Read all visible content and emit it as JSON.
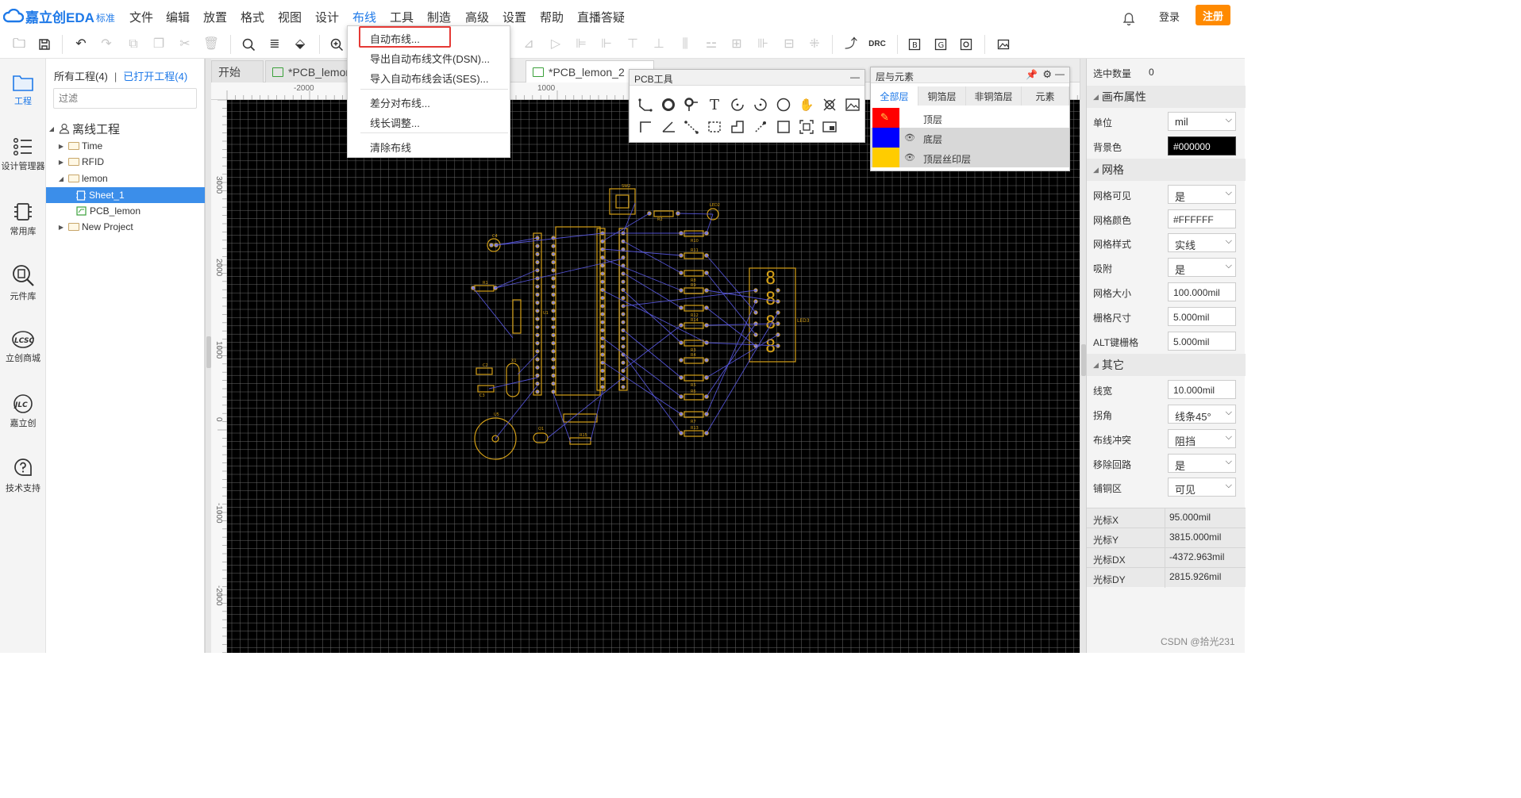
{
  "app": {
    "logo_text": "嘉立创EDA",
    "edition": "标准",
    "menus": [
      "文件",
      "编辑",
      "放置",
      "格式",
      "视图",
      "设计",
      "布线",
      "工具",
      "制造",
      "高级",
      "设置",
      "帮助",
      "直播答疑"
    ],
    "active_menu": "布线",
    "login": "登录",
    "register": "注册",
    "accent_color": "#1E79E8",
    "register_color": "#FF8A00"
  },
  "toolbar": {
    "icons": [
      "open-icon",
      "save-icon",
      "undo-icon",
      "redo-icon",
      "copy-icon",
      "duplicate-icon",
      "cut-icon",
      "delete-icon",
      "zoom-icon",
      "fit-icon",
      "erase-icon",
      "zoom-in-icon"
    ],
    "right_icons": [
      "align-left-icon",
      "align-hcenter-icon",
      "align-right-icon",
      "align-top-icon",
      "align-vcenter-icon",
      "align-bottom-icon",
      "distribute-h-icon",
      "distribute-v-icon",
      "align-grid-icon",
      "snap-icon",
      "route-icon"
    ],
    "drc_label": "DRC",
    "extra_icons": [
      "b-icon",
      "g-icon",
      "photo-icon",
      "image-icon"
    ]
  },
  "leftnav": {
    "items": [
      {
        "label": "工程",
        "icon": "folder-icon",
        "active": true
      },
      {
        "label": "设计管理器",
        "icon": "list-icon"
      },
      {
        "label": "常用库",
        "icon": "chip-icon"
      },
      {
        "label": "元件库",
        "icon": "magnifier-chip-icon"
      },
      {
        "label": "立创商城",
        "icon": "lcsc-icon"
      },
      {
        "label": "嘉立创",
        "icon": "jlc-icon"
      },
      {
        "label": "技术支持",
        "icon": "help-icon"
      }
    ],
    "lcsc_mark": "LCSC",
    "jlc_mark": "JLC"
  },
  "project": {
    "tab_all": "所有工程(4)",
    "tab_sep": "|",
    "tab_open": "已打开工程(4)",
    "filter_placeholder": "过滤",
    "root": "离线工程",
    "items": [
      "Time",
      "RFID",
      "lemon",
      "Sheet_1",
      "PCB_lemon",
      "New Project"
    ]
  },
  "doc_tabs": [
    {
      "label": "开始"
    },
    {
      "label": "*PCB_lemon"
    },
    {
      "label": "*PCB_lemon_2"
    }
  ],
  "rulers": {
    "top": [
      "-2000",
      "1000"
    ],
    "left": [
      "3000",
      "2000",
      "1000",
      "0",
      "-1000",
      "-2000"
    ]
  },
  "dropdown": {
    "items": [
      "自动布线...",
      "导出自动布线文件(DSN)...",
      "导入自动布线会话(SES)...",
      "差分对布线...",
      "线长调整...",
      "清除布线"
    ],
    "highlighted": "自动布线..."
  },
  "pcb_tools": {
    "title": "PCB工具",
    "minimize": "—",
    "row1": [
      "track-icon",
      "pad-icon",
      "via-icon",
      "text-icon",
      "arc-icon",
      "arc-ccw-icon",
      "circle-icon",
      "pan-icon",
      "copper-area-icon",
      "image-icon"
    ],
    "row2": [
      "corner-icon",
      "angle-icon",
      "dimension-icon",
      "select-rect-icon",
      "solid-region-icon",
      "hole-icon",
      "rect-icon",
      "fit-select-icon",
      "board-icon"
    ],
    "text_glyph": "T"
  },
  "layers": {
    "title": "层与元素",
    "tabs": [
      "全部层",
      "铜箔层",
      "非铜箔层",
      "元素"
    ],
    "rows": [
      {
        "name": "顶层",
        "color": "#FF0000"
      },
      {
        "name": "底层",
        "color": "#0000FF"
      },
      {
        "name": "顶层丝印层",
        "color": "#FFCC00"
      }
    ]
  },
  "props": {
    "selected_label": "选中数量",
    "selected_value": "0",
    "sec_canvas": "画布属性",
    "unit_label": "单位",
    "unit": "mil",
    "bg_label": "背景色",
    "bg": "#000000",
    "sec_grid": "网格",
    "grid_visible_label": "网格可见",
    "grid_visible": "是",
    "grid_color_label": "网格颜色",
    "grid_color": "#FFFFFF",
    "grid_style_label": "网格样式",
    "grid_style": "实线",
    "snap_label": "吸附",
    "snap": "是",
    "grid_size_label": "网格大小",
    "grid_size": "100.000mil",
    "snap_size_label": "栅格尺寸",
    "snap_size": "5.000mil",
    "alt_snap_label": "ALT键栅格",
    "alt_snap": "5.000mil",
    "sec_other": "其它",
    "line_width_label": "线宽",
    "line_width": "10.000mil",
    "corner_label": "拐角",
    "corner": "线条45°",
    "conflict_label": "布线冲突",
    "conflict": "阻挡",
    "loop_label": "移除回路",
    "loop": "是",
    "copper_label": "铺铜区",
    "copper": "可见",
    "cx_label": "光标X",
    "cx": "95.000mil",
    "cy_label": "光标Y",
    "cy": "3815.000mil",
    "cdx_label": "光标DX",
    "cdx": "-4372.963mil",
    "cdy_label": "光标DY",
    "cdy": "2815.926mil"
  },
  "pcb": {
    "labels": [
      "SW2",
      "LED2",
      "C4",
      "R1",
      "C2",
      "C3",
      "X1",
      "U5",
      "Q1",
      "R15",
      "R2",
      "R10",
      "R11",
      "R8",
      "R9",
      "R12",
      "R14",
      "R3",
      "R4",
      "R5",
      "R6",
      "R7",
      "R13",
      "U1",
      "LED3"
    ]
  },
  "watermark": "CSDN @拾光231"
}
